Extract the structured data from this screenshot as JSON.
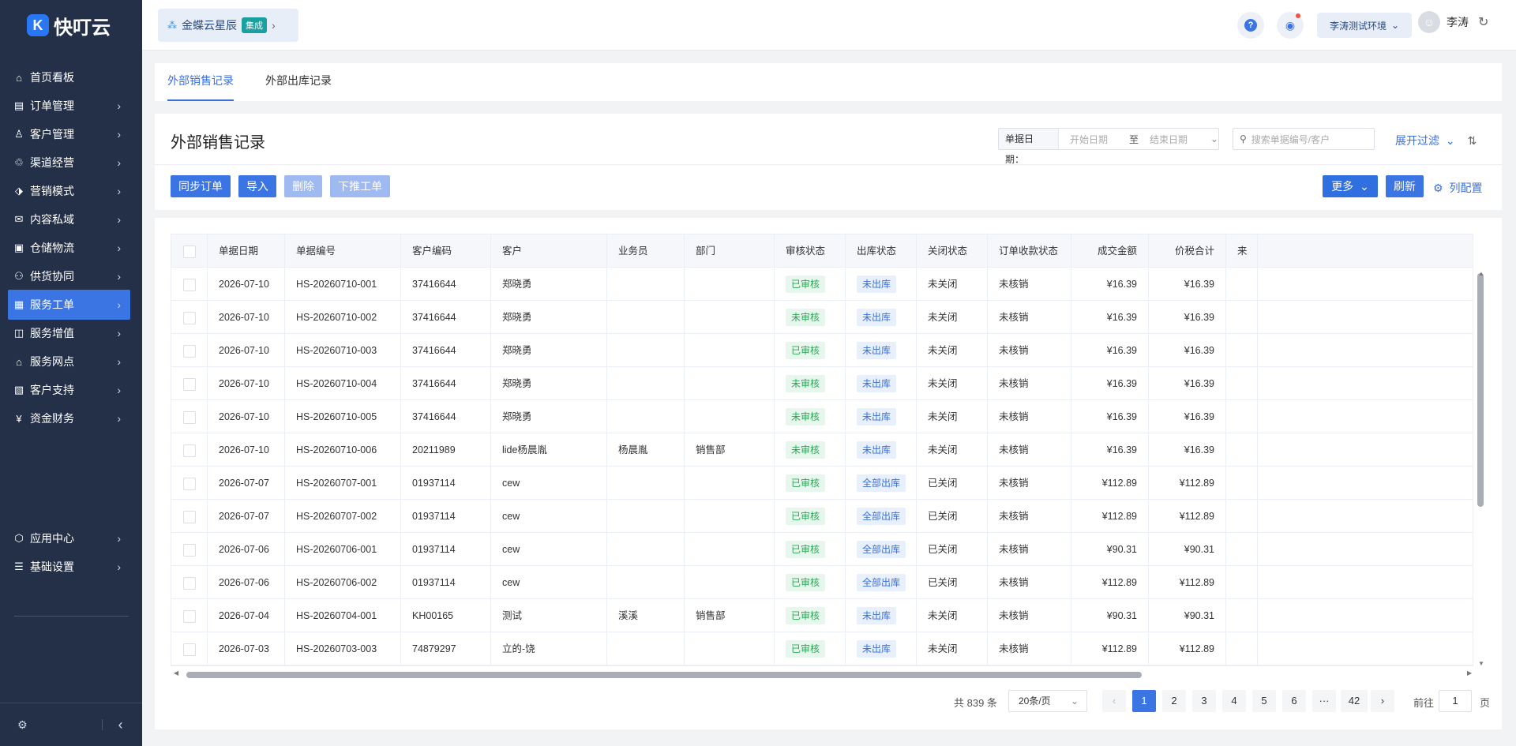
{
  "app": {
    "name": "快叮云",
    "logo_glyph": "K"
  },
  "sidebar": {
    "items": [
      {
        "label": "首页看板",
        "icon": "⌂",
        "arrow": ""
      },
      {
        "label": "订单管理",
        "icon": "▤",
        "arrow": "›"
      },
      {
        "label": "客户管理",
        "icon": "♙",
        "arrow": "›"
      },
      {
        "label": "渠道经营",
        "icon": "♲",
        "arrow": "›"
      },
      {
        "label": "营销模式",
        "icon": "⬗",
        "arrow": "›"
      },
      {
        "label": "内容私域",
        "icon": "✉",
        "arrow": "›"
      },
      {
        "label": "仓储物流",
        "icon": "▣",
        "arrow": "›"
      },
      {
        "label": "供货协同",
        "icon": "⚇",
        "arrow": "›"
      },
      {
        "label": "服务工单",
        "icon": "▦",
        "arrow": "›"
      },
      {
        "label": "服务增值",
        "icon": "◫",
        "arrow": "›"
      },
      {
        "label": "服务网点",
        "icon": "⌂",
        "arrow": "›"
      },
      {
        "label": "客户支持",
        "icon": "▧",
        "arrow": "›"
      },
      {
        "label": "资金财务",
        "icon": "¥",
        "arrow": "›"
      },
      {
        "label": "应用中心",
        "icon": "⬡",
        "arrow": "›"
      },
      {
        "label": "基础设置",
        "icon": "☰",
        "arrow": "›"
      }
    ],
    "footer_settings_icon": "⚙",
    "footer_collapse_icon": "‹"
  },
  "topbar": {
    "app_switch_label": "金蝶云星辰",
    "app_switch_badge": "集成",
    "app_switch_arrow": "›",
    "help_icon": "?",
    "bell_icon": "🔔",
    "env_label": "李涛测试环境",
    "env_arrow": "⌄",
    "user_name": "李涛",
    "refresh_icon": "↻"
  },
  "tabs": [
    "外部销售记录",
    "外部出库记录"
  ],
  "page": {
    "title": "外部销售记录",
    "date_label": "单据日期：",
    "date_start_placeholder": "开始日期",
    "date_to": "至",
    "date_end_placeholder": "结束日期",
    "search_placeholder": "搜索单据编号/客户",
    "expand_filter": "展开过滤",
    "sort_icon": "⇅"
  },
  "toolbar": {
    "sync": "同步订单",
    "import": "导入",
    "delete": "删除",
    "push": "下推工单",
    "more": "更多",
    "refresh": "刷新",
    "column_config": "列配置"
  },
  "table": {
    "columns": [
      "单据日期",
      "单据编号",
      "客户编码",
      "客户",
      "业务员",
      "部门",
      "审核状态",
      "出库状态",
      "关闭状态",
      "订单收款状态",
      "成交金额",
      "价税合计",
      "来"
    ],
    "rows": [
      [
        "2026-07-10",
        "HS-20260710-001",
        "37416644",
        "郑晓勇",
        "",
        "",
        "已审核",
        "未出库",
        "未关闭",
        "未核销",
        "¥16.39",
        "¥16.39"
      ],
      [
        "2026-07-10",
        "HS-20260710-002",
        "37416644",
        "郑晓勇",
        "",
        "",
        "未审核",
        "未出库",
        "未关闭",
        "未核销",
        "¥16.39",
        "¥16.39"
      ],
      [
        "2026-07-10",
        "HS-20260710-003",
        "37416644",
        "郑晓勇",
        "",
        "",
        "已审核",
        "未出库",
        "未关闭",
        "未核销",
        "¥16.39",
        "¥16.39"
      ],
      [
        "2026-07-10",
        "HS-20260710-004",
        "37416644",
        "郑晓勇",
        "",
        "",
        "未审核",
        "未出库",
        "未关闭",
        "未核销",
        "¥16.39",
        "¥16.39"
      ],
      [
        "2026-07-10",
        "HS-20260710-005",
        "37416644",
        "郑晓勇",
        "",
        "",
        "未审核",
        "未出库",
        "未关闭",
        "未核销",
        "¥16.39",
        "¥16.39"
      ],
      [
        "2026-07-10",
        "HS-20260710-006",
        "20211989",
        "lide杨晨胤",
        "杨晨胤",
        "销售部",
        "未审核",
        "未出库",
        "未关闭",
        "未核销",
        "¥16.39",
        "¥16.39"
      ],
      [
        "2026-07-07",
        "HS-20260707-001",
        "01937114",
        "cew",
        "",
        "",
        "已审核",
        "全部出库",
        "已关闭",
        "未核销",
        "¥112.89",
        "¥112.89"
      ],
      [
        "2026-07-07",
        "HS-20260707-002",
        "01937114",
        "cew",
        "",
        "",
        "已审核",
        "全部出库",
        "已关闭",
        "未核销",
        "¥112.89",
        "¥112.89"
      ],
      [
        "2026-07-06",
        "HS-20260706-001",
        "01937114",
        "cew",
        "",
        "",
        "已审核",
        "全部出库",
        "已关闭",
        "未核销",
        "¥90.31",
        "¥90.31"
      ],
      [
        "2026-07-06",
        "HS-20260706-002",
        "01937114",
        "cew",
        "",
        "",
        "已审核",
        "全部出库",
        "已关闭",
        "未核销",
        "¥112.89",
        "¥112.89"
      ],
      [
        "2026-07-04",
        "HS-20260704-001",
        "KH00165",
        "测试",
        "溪溪",
        "销售部",
        "已审核",
        "未出库",
        "未关闭",
        "未核销",
        "¥90.31",
        "¥90.31"
      ],
      [
        "2026-07-03",
        "HS-20260703-003",
        "74879297",
        "立的-饶",
        "",
        "",
        "已审核",
        "未出库",
        "未关闭",
        "未核销",
        "¥112.89",
        "¥112.89"
      ]
    ]
  },
  "pagination": {
    "total": "共 839 条",
    "page_size": "20条/页",
    "prev": "‹",
    "next": "›",
    "pages": [
      "1",
      "2",
      "3",
      "4",
      "5",
      "6",
      "···",
      "42"
    ],
    "goto_label": "前往",
    "goto_value": "1",
    "goto_suffix": "页"
  },
  "colors": {
    "accent": "#3b74e3",
    "sidebar_bg": "#243047",
    "approved": "#2ba657"
  }
}
